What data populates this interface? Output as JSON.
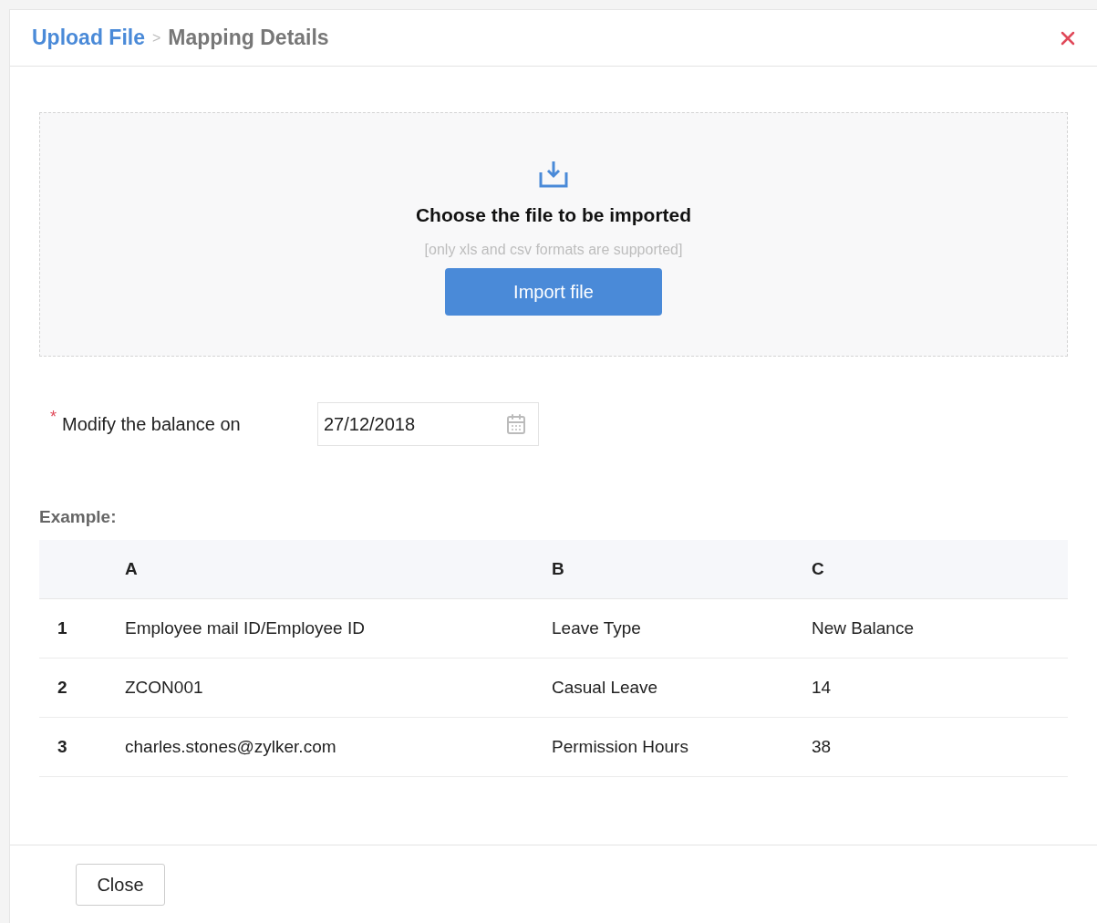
{
  "breadcrumb": {
    "link": "Upload File",
    "separator": ">",
    "current": "Mapping Details"
  },
  "drop_zone": {
    "title": "Choose the file to be imported",
    "hint": "[only xls and csv formats are supported]",
    "button": "Import file"
  },
  "date_field": {
    "required_mark": "*",
    "label": "Modify the balance on",
    "value": "27/12/2018"
  },
  "example": {
    "label": "Example:",
    "columns": [
      "A",
      "B",
      "C"
    ],
    "rows": [
      {
        "index": "1",
        "cells": [
          "Employee mail ID/Employee ID",
          "Leave Type",
          "New Balance"
        ]
      },
      {
        "index": "2",
        "cells": [
          "ZCON001",
          "Casual Leave",
          "14"
        ]
      },
      {
        "index": "3",
        "cells": [
          "charles.stones@zylker.com",
          "Permission Hours",
          "38"
        ]
      }
    ]
  },
  "footer": {
    "button": "Close"
  }
}
